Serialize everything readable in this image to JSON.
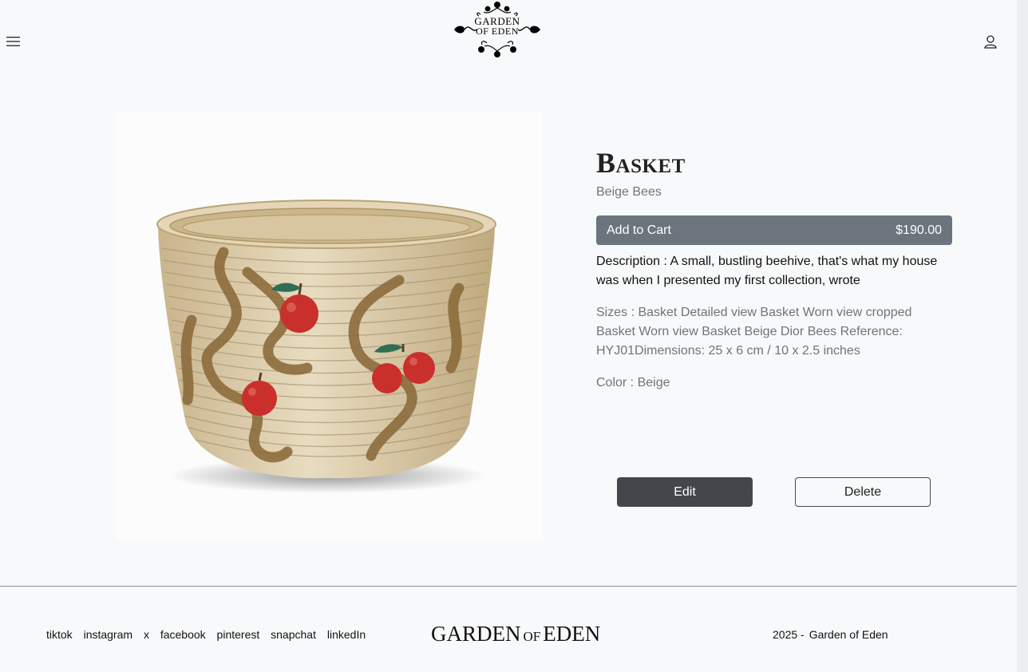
{
  "header": {
    "logo_text_line1": "GARDEN",
    "logo_text_line2": "OF EDEN",
    "menu_icon": "hamburger-menu-icon",
    "user_icon": "user-icon"
  },
  "product": {
    "title": "Basket",
    "subtitle": "Beige Bees",
    "cart_label": "Add to Cart",
    "price": "$190.00",
    "description": "Description : A small, bustling beehive, that's what my house was when I presented my first collection, wrote",
    "sizes": "Sizes : Basket Detailed view Basket Worn view cropped Basket Worn view Basket Beige Dior Bees Reference: HYJ01Dimensions: 25 x 6 cm / 10 x 2.5 inches",
    "color": "Color : Beige",
    "image_subject": "woven basket with apples and snakes"
  },
  "actions": {
    "edit_label": "Edit",
    "delete_label": "Delete"
  },
  "footer": {
    "social": [
      "tiktok",
      "instagram",
      "x",
      "facebook",
      "pinterest",
      "snapchat",
      "linkedIn"
    ],
    "logo_main1": "GARDEN",
    "logo_small": "OF",
    "logo_main2": "EDEN",
    "copyright_year": "2025 -",
    "copyright_name": "Garden of Eden"
  },
  "colors": {
    "background": "#f8f9fa",
    "cart_button": "#6c757d",
    "edit_button": "#43474c",
    "muted_text": "#6c757d"
  }
}
